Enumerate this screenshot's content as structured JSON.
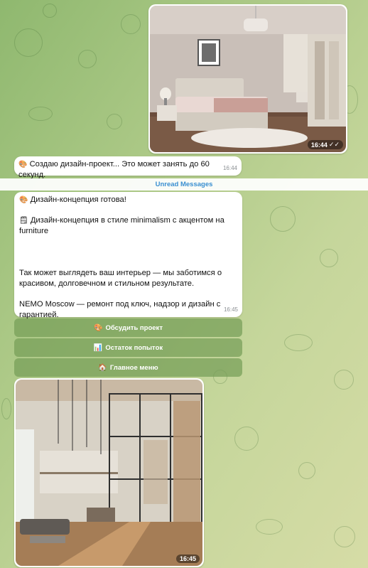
{
  "messages": {
    "photo1": {
      "time": "16:44",
      "ticks": "✓✓"
    },
    "status": {
      "icon": "🎨",
      "text": "Создаю дизайн-проект... Это может занять до 60 секунд.",
      "time": "16:44"
    },
    "divider": "Unread Messages",
    "concept": {
      "line1_icon": "🎨",
      "line1": "Дизайн-концепция готова!",
      "line2_icon": "🗒",
      "line2": "Дизайн-концепция в стиле minimalism с акцентом на furniture",
      "line3": "Так может выглядеть ваш интерьер — мы заботимся о красивом, долговечном и стильном результате.",
      "line4": "NEMO Moscow — ремонт под ключ, надзор и дизайн с гарантией.",
      "time": "16:45"
    },
    "buttons": [
      {
        "icon": "🎨",
        "label": "Обсудить проект"
      },
      {
        "icon": "📊",
        "label": "Остаток попыток"
      },
      {
        "icon": "🏠",
        "label": "Главное меню"
      }
    ],
    "photo2": {
      "time": "16:45"
    }
  }
}
